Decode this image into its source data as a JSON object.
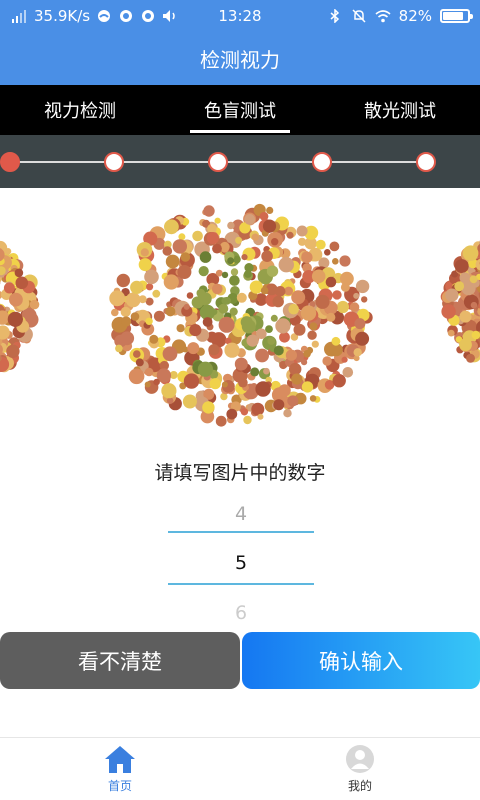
{
  "status_bar": {
    "network_speed": "35.9K/s",
    "time": "13:28",
    "battery": "82%",
    "battery_level": 0.82,
    "icons": [
      "signal-icon",
      "cloud-icon",
      "qq-icon",
      "qq-icon",
      "volume-icon",
      "bluetooth-icon",
      "mute-icon",
      "wifi-icon",
      "battery-icon"
    ]
  },
  "header": {
    "title": "检测视力"
  },
  "tabs": [
    {
      "label": "视力检测",
      "active": false
    },
    {
      "label": "色盲测试",
      "active": true
    },
    {
      "label": "散光测试",
      "active": false
    }
  ],
  "progress": {
    "total_steps": 5,
    "current_step": 1
  },
  "main": {
    "prompt": "请填写图片中的数字",
    "picker": {
      "prev": "4",
      "current": "5",
      "next": "6"
    }
  },
  "buttons": {
    "unclear": "看不清楚",
    "confirm": "确认输入"
  },
  "bottom_nav": [
    {
      "label": "首页",
      "icon": "home-icon",
      "active": true
    },
    {
      "label": "我的",
      "icon": "user-avatar-icon",
      "active": false
    }
  ],
  "colors": {
    "primary": "#4a8fe6",
    "accent_red": "#e0594a",
    "active_nav": "#3a7fdf",
    "picker_line": "#5db7df"
  }
}
